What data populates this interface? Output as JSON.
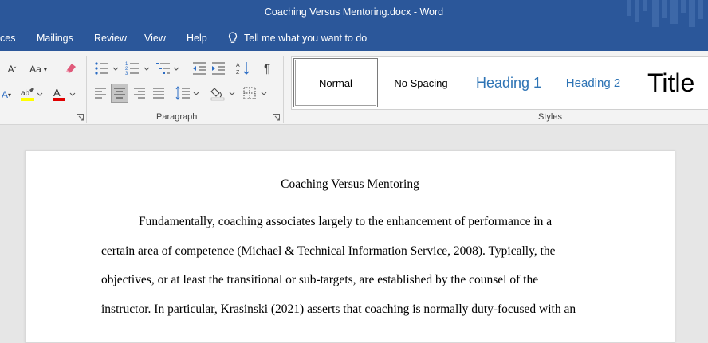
{
  "window": {
    "title": "Coaching Versus Mentoring.docx  -  Word"
  },
  "menu": {
    "items": [
      "ces",
      "Mailings",
      "Review",
      "View",
      "Help"
    ],
    "tell_me": "Tell me what you want to do"
  },
  "ribbon": {
    "font_case_label": "Aa",
    "paragraph_group_label": "Paragraph",
    "styles_group_label": "Styles",
    "styles": [
      "Normal",
      "No Spacing",
      "Heading 1",
      "Heading 2",
      "Title"
    ],
    "highlight_color": "#ffff00",
    "font_color": "#e00000"
  },
  "document": {
    "title": "Coaching Versus Mentoring",
    "lines": [
      "Fundamentally, coaching associates largely to the enhancement of performance in a",
      "certain area of competence (Michael & Technical Information Service, 2008). Typically, the",
      "objectives, or at least the transitional or sub-targets, are established by the counsel of the",
      "instructor. In particular, Krasinski (2021) asserts that coaching is normally duty-focused with an"
    ]
  }
}
